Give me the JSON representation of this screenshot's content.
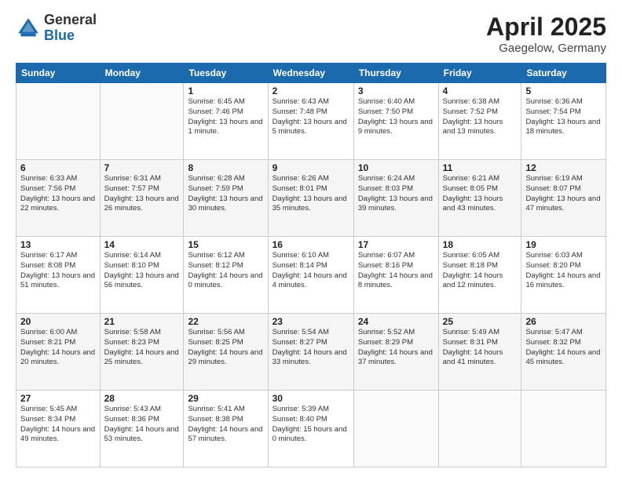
{
  "logo": {
    "general": "General",
    "blue": "Blue"
  },
  "title": "April 2025",
  "location": "Gaegelow, Germany",
  "days_of_week": [
    "Sunday",
    "Monday",
    "Tuesday",
    "Wednesday",
    "Thursday",
    "Friday",
    "Saturday"
  ],
  "weeks": [
    [
      {
        "day": "",
        "info": ""
      },
      {
        "day": "",
        "info": ""
      },
      {
        "day": "1",
        "info": "Sunrise: 6:45 AM\nSunset: 7:46 PM\nDaylight: 13 hours and 1 minute."
      },
      {
        "day": "2",
        "info": "Sunrise: 6:43 AM\nSunset: 7:48 PM\nDaylight: 13 hours and 5 minutes."
      },
      {
        "day": "3",
        "info": "Sunrise: 6:40 AM\nSunset: 7:50 PM\nDaylight: 13 hours and 9 minutes."
      },
      {
        "day": "4",
        "info": "Sunrise: 6:38 AM\nSunset: 7:52 PM\nDaylight: 13 hours and 13 minutes."
      },
      {
        "day": "5",
        "info": "Sunrise: 6:36 AM\nSunset: 7:54 PM\nDaylight: 13 hours and 18 minutes."
      }
    ],
    [
      {
        "day": "6",
        "info": "Sunrise: 6:33 AM\nSunset: 7:56 PM\nDaylight: 13 hours and 22 minutes."
      },
      {
        "day": "7",
        "info": "Sunrise: 6:31 AM\nSunset: 7:57 PM\nDaylight: 13 hours and 26 minutes."
      },
      {
        "day": "8",
        "info": "Sunrise: 6:28 AM\nSunset: 7:59 PM\nDaylight: 13 hours and 30 minutes."
      },
      {
        "day": "9",
        "info": "Sunrise: 6:26 AM\nSunset: 8:01 PM\nDaylight: 13 hours and 35 minutes."
      },
      {
        "day": "10",
        "info": "Sunrise: 6:24 AM\nSunset: 8:03 PM\nDaylight: 13 hours and 39 minutes."
      },
      {
        "day": "11",
        "info": "Sunrise: 6:21 AM\nSunset: 8:05 PM\nDaylight: 13 hours and 43 minutes."
      },
      {
        "day": "12",
        "info": "Sunrise: 6:19 AM\nSunset: 8:07 PM\nDaylight: 13 hours and 47 minutes."
      }
    ],
    [
      {
        "day": "13",
        "info": "Sunrise: 6:17 AM\nSunset: 8:08 PM\nDaylight: 13 hours and 51 minutes."
      },
      {
        "day": "14",
        "info": "Sunrise: 6:14 AM\nSunset: 8:10 PM\nDaylight: 13 hours and 56 minutes."
      },
      {
        "day": "15",
        "info": "Sunrise: 6:12 AM\nSunset: 8:12 PM\nDaylight: 14 hours and 0 minutes."
      },
      {
        "day": "16",
        "info": "Sunrise: 6:10 AM\nSunset: 8:14 PM\nDaylight: 14 hours and 4 minutes."
      },
      {
        "day": "17",
        "info": "Sunrise: 6:07 AM\nSunset: 8:16 PM\nDaylight: 14 hours and 8 minutes."
      },
      {
        "day": "18",
        "info": "Sunrise: 6:05 AM\nSunset: 8:18 PM\nDaylight: 14 hours and 12 minutes."
      },
      {
        "day": "19",
        "info": "Sunrise: 6:03 AM\nSunset: 8:20 PM\nDaylight: 14 hours and 16 minutes."
      }
    ],
    [
      {
        "day": "20",
        "info": "Sunrise: 6:00 AM\nSunset: 8:21 PM\nDaylight: 14 hours and 20 minutes."
      },
      {
        "day": "21",
        "info": "Sunrise: 5:58 AM\nSunset: 8:23 PM\nDaylight: 14 hours and 25 minutes."
      },
      {
        "day": "22",
        "info": "Sunrise: 5:56 AM\nSunset: 8:25 PM\nDaylight: 14 hours and 29 minutes."
      },
      {
        "day": "23",
        "info": "Sunrise: 5:54 AM\nSunset: 8:27 PM\nDaylight: 14 hours and 33 minutes."
      },
      {
        "day": "24",
        "info": "Sunrise: 5:52 AM\nSunset: 8:29 PM\nDaylight: 14 hours and 37 minutes."
      },
      {
        "day": "25",
        "info": "Sunrise: 5:49 AM\nSunset: 8:31 PM\nDaylight: 14 hours and 41 minutes."
      },
      {
        "day": "26",
        "info": "Sunrise: 5:47 AM\nSunset: 8:32 PM\nDaylight: 14 hours and 45 minutes."
      }
    ],
    [
      {
        "day": "27",
        "info": "Sunrise: 5:45 AM\nSunset: 8:34 PM\nDaylight: 14 hours and 49 minutes."
      },
      {
        "day": "28",
        "info": "Sunrise: 5:43 AM\nSunset: 8:36 PM\nDaylight: 14 hours and 53 minutes."
      },
      {
        "day": "29",
        "info": "Sunrise: 5:41 AM\nSunset: 8:38 PM\nDaylight: 14 hours and 57 minutes."
      },
      {
        "day": "30",
        "info": "Sunrise: 5:39 AM\nSunset: 8:40 PM\nDaylight: 15 hours and 0 minutes."
      },
      {
        "day": "",
        "info": ""
      },
      {
        "day": "",
        "info": ""
      },
      {
        "day": "",
        "info": ""
      }
    ]
  ]
}
